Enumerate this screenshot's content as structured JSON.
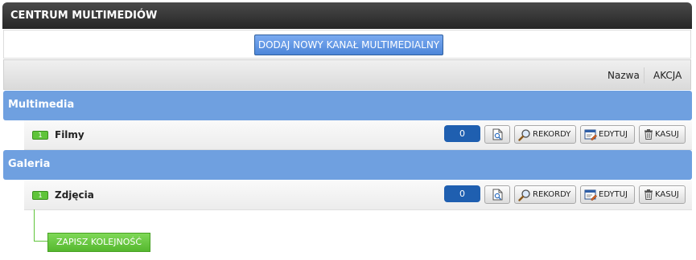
{
  "header": {
    "title": "CENTRUM MULTIMEDIÓW"
  },
  "toolbar": {
    "add_label": "DODAJ NOWY KANAŁ MULTIMEDIALNY"
  },
  "columns": {
    "name": "Nazwa",
    "action": "AKCJA"
  },
  "groups": [
    {
      "title": "Multimedia",
      "row": {
        "badge": "1",
        "label": "Filmy",
        "count": "0"
      }
    },
    {
      "title": "Galeria",
      "row": {
        "badge": "1",
        "label": "Zdjęcia",
        "count": "0"
      }
    }
  ],
  "actions": {
    "records": "REKORDY",
    "edit": "EDYTUJ",
    "delete": "KASUJ"
  },
  "footer": {
    "save_label": "ZAPISZ KOLEJNOŚĆ"
  },
  "icons": {
    "preview": "page-preview-icon",
    "records": "magnifier-icon",
    "edit": "edit-window-icon",
    "delete": "trash-icon"
  },
  "colors": {
    "group": "#6fa0e0",
    "badge": "#5fc43a",
    "count": "#1f5fb0",
    "add_button": "#4d86d9"
  }
}
